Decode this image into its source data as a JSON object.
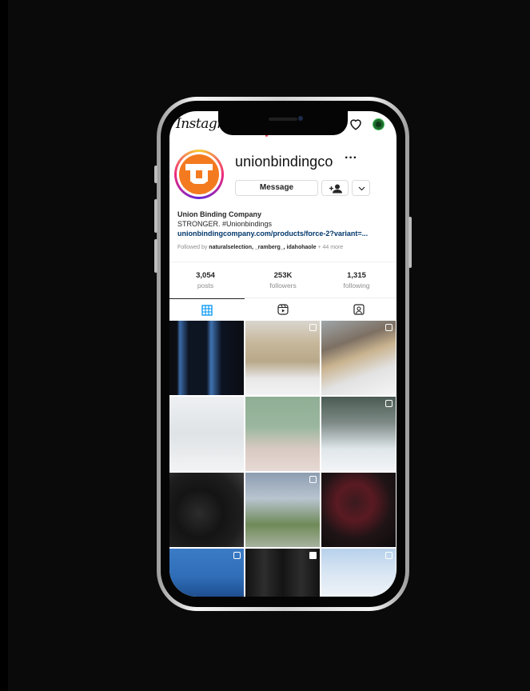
{
  "app": {
    "name": "Instagram"
  },
  "profile": {
    "username": "unionbindingco",
    "more_label": "···",
    "message_button": "Message"
  },
  "bio": {
    "name": "Union Binding Company",
    "tagline": "STRONGER. #Unionbindings",
    "link": "unionbindingcompany.com/products/force-2?variant=...",
    "followed_prefix": "Followed by ",
    "followed_names": "naturalselection, _ramberg_, idahohaole",
    "followed_more": " + 44 more"
  },
  "stats": [
    {
      "value": "3,054",
      "label": "posts"
    },
    {
      "value": "253K",
      "label": "followers"
    },
    {
      "value": "1,315",
      "label": "following"
    }
  ],
  "tabs": [
    {
      "icon": "grid-icon",
      "active": true
    },
    {
      "icon": "reels-icon",
      "active": false
    },
    {
      "icon": "tagged-icon",
      "active": false
    }
  ],
  "colors": {
    "accent": "#0095f6",
    "brand": "#f47a20",
    "link": "#00376b"
  }
}
